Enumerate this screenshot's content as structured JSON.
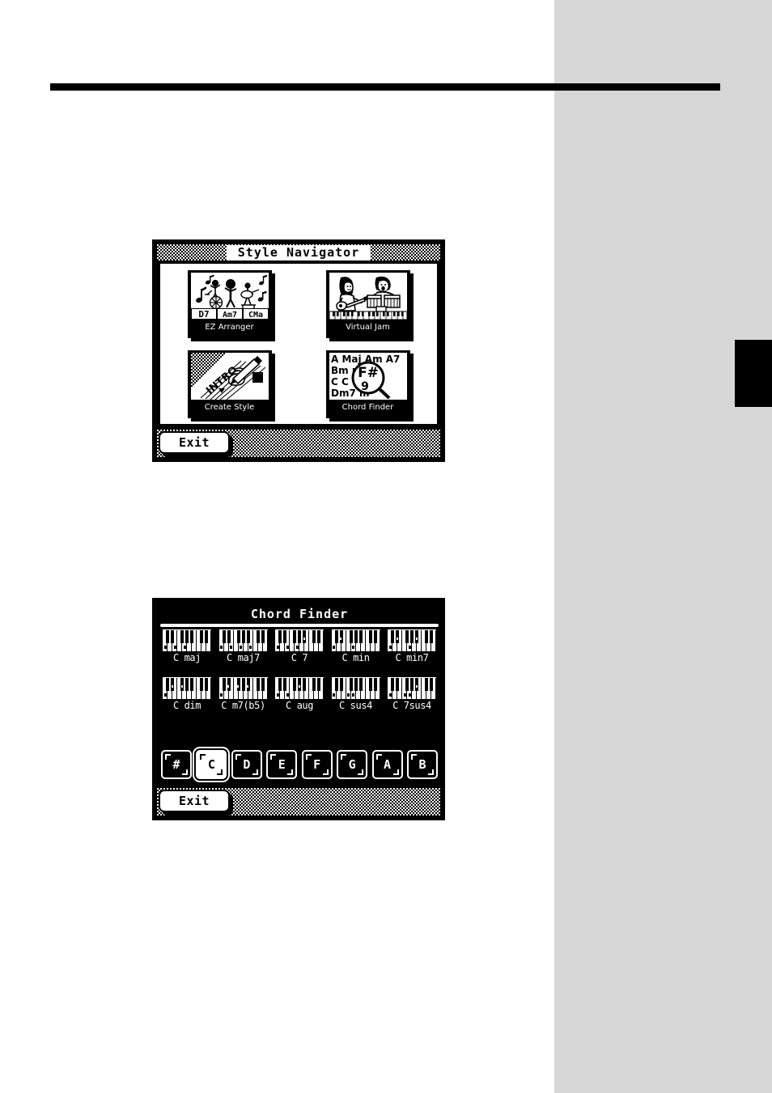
{
  "page": {
    "background_color": "#ffffff",
    "sidebar_color": "#d7d7d7",
    "rule_color": "#000000",
    "tab_color": "#000000"
  },
  "screens": [
    {
      "id": "style-navigator",
      "title": "Style Navigator",
      "tiles": [
        {
          "id": "ez-arranger",
          "label": "EZ Arranger",
          "icon": "band-chords-icon",
          "chords": [
            "D7",
            "Am7",
            "CMa"
          ]
        },
        {
          "id": "virtual-jam",
          "label": "Virtual Jam",
          "icon": "guitarist-drummer-icon"
        },
        {
          "id": "create-style",
          "label": "Create Style",
          "icon": "hand-writing-intro-icon",
          "word": "INTRO"
        },
        {
          "id": "chord-finder",
          "label": "Chord Finder",
          "icon": "magnifier-chordlist-icon",
          "magnifier_text": "F#",
          "chord_list_rows": [
            "A Maj Am A7",
            "Bm        m7",
            "C C      Cm",
            "Dm7      m"
          ]
        }
      ],
      "exit_label": "Exit"
    },
    {
      "id": "chord-finder",
      "title": "Chord Finder",
      "chords": [
        {
          "label": "C maj",
          "keys": [
            0,
            4,
            7
          ]
        },
        {
          "label": "C maj7",
          "keys": [
            0,
            4,
            7,
            11
          ]
        },
        {
          "label": "C 7",
          "keys": [
            0,
            4,
            7,
            10
          ]
        },
        {
          "label": "C min",
          "keys": [
            0,
            3,
            7
          ]
        },
        {
          "label": "C min7",
          "keys": [
            0,
            3,
            7,
            10
          ]
        },
        {
          "label": "C dim",
          "keys": [
            0,
            3,
            6
          ]
        },
        {
          "label": "C m7(b5)",
          "keys": [
            0,
            3,
            6,
            10
          ]
        },
        {
          "label": "C aug",
          "keys": [
            0,
            4,
            8
          ]
        },
        {
          "label": "C sus4",
          "keys": [
            0,
            5,
            7
          ]
        },
        {
          "label": "C 7sus4",
          "keys": [
            0,
            5,
            7,
            10
          ]
        }
      ],
      "note_buttons": [
        {
          "label": "#",
          "selected": false
        },
        {
          "label": "C",
          "selected": true
        },
        {
          "label": "D",
          "selected": false
        },
        {
          "label": "E",
          "selected": false
        },
        {
          "label": "F",
          "selected": false
        },
        {
          "label": "G",
          "selected": false
        },
        {
          "label": "A",
          "selected": false
        },
        {
          "label": "B",
          "selected": false
        }
      ],
      "exit_label": "Exit"
    }
  ]
}
